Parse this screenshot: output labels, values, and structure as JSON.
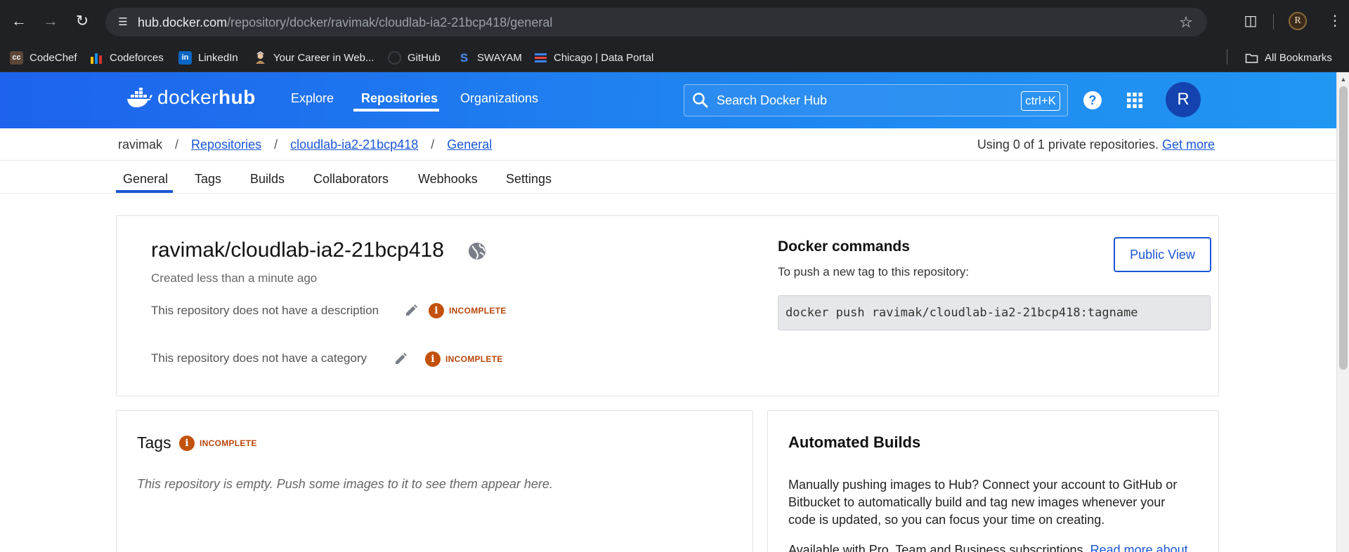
{
  "browser": {
    "url_host": "hub.docker.com",
    "url_path": "/repository/docker/ravimak/cloudlab-ia2-21bcp418/general",
    "bookmarks": [
      {
        "label": "CodeChef",
        "icon": "codechef-icon"
      },
      {
        "label": "Codeforces",
        "icon": "codeforces-icon"
      },
      {
        "label": "LinkedIn",
        "icon": "linkedin-icon"
      },
      {
        "label": "Your Career in Web...",
        "icon": "career-icon"
      },
      {
        "label": "GitHub",
        "icon": "github-icon"
      },
      {
        "label": "SWAYAM",
        "icon": "swayam-icon"
      },
      {
        "label": "Chicago | Data Portal",
        "icon": "chicago-icon"
      }
    ],
    "all_bookmarks": "All Bookmarks",
    "profile_initial": "R"
  },
  "header": {
    "logo_docker": "docker",
    "logo_hub": "hub",
    "nav": [
      "Explore",
      "Repositories",
      "Organizations"
    ],
    "active_nav": "Repositories",
    "search_placeholder": "Search Docker Hub",
    "search_shortcut": "ctrl+K",
    "avatar_initial": "R",
    "brand_color": "#1d63ed"
  },
  "breadcrumb": {
    "user": "ravimak",
    "repositories": "Repositories",
    "repo": "cloudlab-ia2-21bcp418",
    "page": "General",
    "separator": "/"
  },
  "usage": {
    "text": "Using 0 of 1 private repositories.",
    "link": "Get more"
  },
  "tabs": [
    "General",
    "Tags",
    "Builds",
    "Collaborators",
    "Webhooks",
    "Settings"
  ],
  "active_tab": "General",
  "repo": {
    "title": "ravimak/cloudlab-ia2-21bcp418",
    "created": "Created less than a minute ago",
    "description_missing": "This repository does not have a description",
    "category_missing": "This repository does not have a category",
    "incomplete_label": "INCOMPLETE",
    "public_view_label": "Public View"
  },
  "docker_commands": {
    "title": "Docker commands",
    "subtitle": "To push a new tag to this repository:",
    "command": "docker push ravimak/cloudlab-ia2-21bcp418:tagname"
  },
  "tags_card": {
    "title": "Tags",
    "incomplete_label": "INCOMPLETE",
    "empty_message": "This repository is empty. Push some images to it to see them appear here."
  },
  "builds_card": {
    "title": "Automated Builds",
    "body": "Manually pushing images to Hub? Connect your account to GitHub or Bitbucket to automatically build and tag new images whenever your code is updated, so you can focus your time on creating.",
    "available_text": "Available with Pro, Team and Business subscriptions.",
    "read_more": "Read more about"
  },
  "colors": {
    "link": "#1a56d6",
    "incomplete": "#c2510b"
  }
}
